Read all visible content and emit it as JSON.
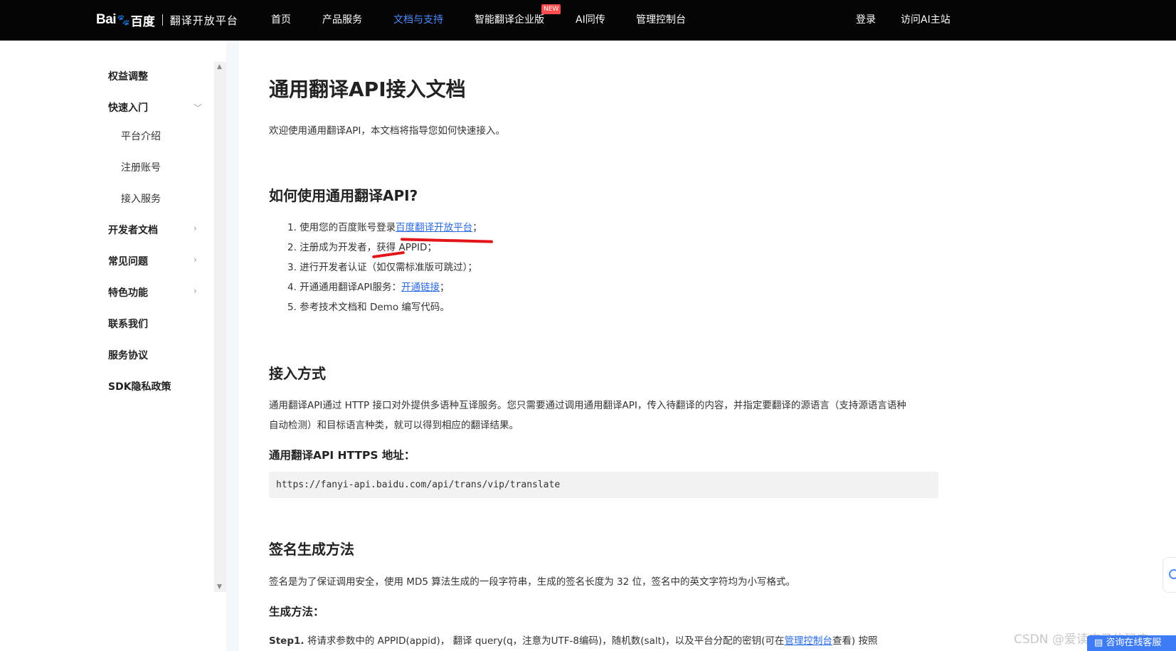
{
  "header": {
    "logo_bai": "Bai",
    "logo_du": "百度",
    "platform_name": "翻译开放平台",
    "nav": [
      {
        "label": "首页"
      },
      {
        "label": "产品服务"
      },
      {
        "label": "文档与支持"
      },
      {
        "label": "智能翻译企业版"
      },
      {
        "label": "AI同传"
      },
      {
        "label": "管理控制台"
      }
    ],
    "new_badge": "NEW",
    "login": "登录",
    "visit_ai": "访问AI主站"
  },
  "sidebar": {
    "items": [
      {
        "label": "权益调整"
      },
      {
        "label": "快速入门"
      },
      {
        "label": "平台介绍"
      },
      {
        "label": "注册账号"
      },
      {
        "label": "接入服务"
      },
      {
        "label": "开发者文档"
      },
      {
        "label": "常见问题"
      },
      {
        "label": "特色功能"
      },
      {
        "label": "联系我们"
      },
      {
        "label": "服务协议"
      },
      {
        "label": "SDK隐私政策"
      }
    ]
  },
  "doc": {
    "title": "通用翻译API接入文档",
    "intro": "欢迎使用通用翻译API，本文档将指导您如何快速接入。",
    "howto_heading": "如何使用通用翻译API?",
    "steps": {
      "s1_prefix": "使用您的百度账号登录",
      "s1_link": "百度翻译开放平台",
      "s1_suffix": "；",
      "s2": "注册成为开发者，获得 APPID；",
      "s3": "进行开发者认证（如仅需标准版可跳过）；",
      "s4_prefix": "开通通用翻译API服务：",
      "s4_link": "开通链接",
      "s4_suffix": "；",
      "s5": "参考技术文档和 Demo 编写代码。"
    },
    "access_heading": "接入方式",
    "access_text_1": "通用翻译API通过 HTTP 接口对外提供多语种互译服务。您只需要通过调用通用翻译API，传入待翻译的内容，并指定要翻译的源语言（支持源语言语种",
    "access_text_2": "自动检测）和目标语言种类，就可以得到相应的翻译结果。",
    "https_heading": "通用翻译API HTTPS 地址：",
    "https_url": "https://fanyi-api.baidu.com/api/trans/vip/translate",
    "sign_heading": "签名生成方法",
    "sign_text": "签名是为了保证调用安全，使用 MD5 算法生成的一段字符串，生成的签名长度为 32 位，签名中的英文字符均为小写格式。",
    "gen_heading": "生成方法：",
    "step1_label": "Step1.",
    "step1_text_a": " 将请求参数中的 APPID(appid)， 翻译 query(q，注意为UTF-8编码)，随机数(salt)，以及平台分配的密钥(可在",
    "step1_link": "管理控制台",
    "step1_text_b": "查看) 按照"
  },
  "widgets": {
    "consult": "咨询在线客服",
    "watermark": "CSDN @爱读庄子的码农"
  }
}
